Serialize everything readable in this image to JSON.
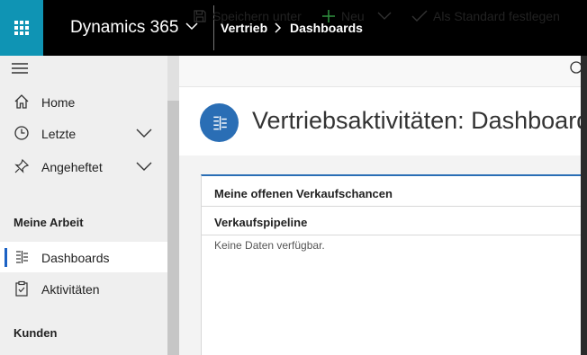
{
  "app": {
    "name": "Dynamics 365",
    "breadcrumb": [
      "Vertrieb",
      "Dashboards"
    ]
  },
  "sidebar": {
    "items": [
      {
        "label": "Home",
        "icon": "home-icon"
      },
      {
        "label": "Letzte",
        "icon": "clock-icon",
        "expandable": true
      },
      {
        "label": "Angeheftet",
        "icon": "pin-icon",
        "expandable": true
      }
    ],
    "sections": [
      {
        "title": "Meine Arbeit",
        "items": [
          {
            "label": "Dashboards",
            "icon": "dashboard-icon",
            "active": true
          },
          {
            "label": "Aktivitäten",
            "icon": "clipboard-icon"
          }
        ]
      },
      {
        "title": "Kunden",
        "items": []
      }
    ]
  },
  "commandbar": {
    "save_as": "Speichern unter",
    "new": "Neu",
    "set_default": "Als Standard festlegen"
  },
  "page": {
    "title": "Vertriebsaktivitäten: Dashboard"
  },
  "panel": {
    "title": "Meine offenen Verkaufschancen",
    "chart_title": "Verkaufspipeline",
    "empty_message": "Keine Daten verfügbar."
  },
  "colors": {
    "accent": "#0f94b4",
    "topbar": "#000000",
    "brand_blue": "#2a6eb5",
    "active_indicator": "#1c62c4"
  }
}
